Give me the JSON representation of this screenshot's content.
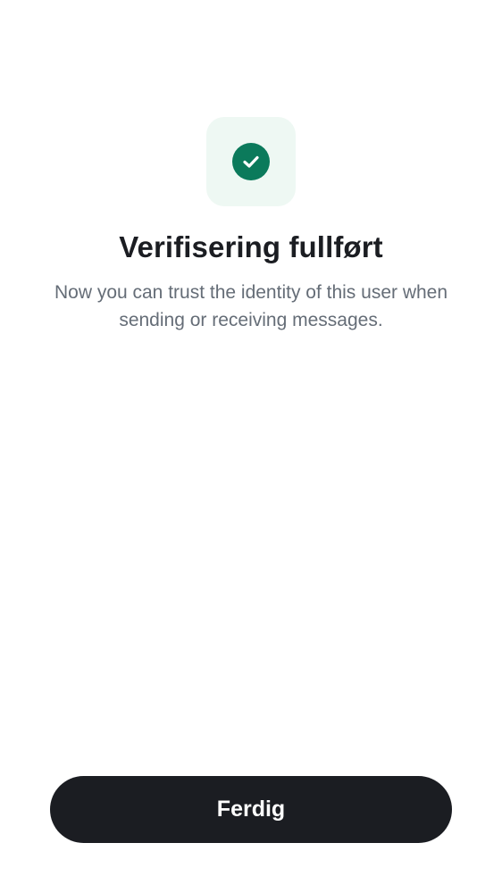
{
  "icon": {
    "name": "check-circle-icon",
    "tile_color": "#eef8f3",
    "circle_color": "#0b7a5b"
  },
  "title": "Verifisering fullført",
  "subtitle": "Now you can trust the identity of this user when sending or receiving messages.",
  "actions": {
    "done_label": "Ferdig"
  },
  "colors": {
    "primary_button": "#1b1d22",
    "text_primary": "#1b1d22",
    "text_secondary": "#656d77"
  }
}
